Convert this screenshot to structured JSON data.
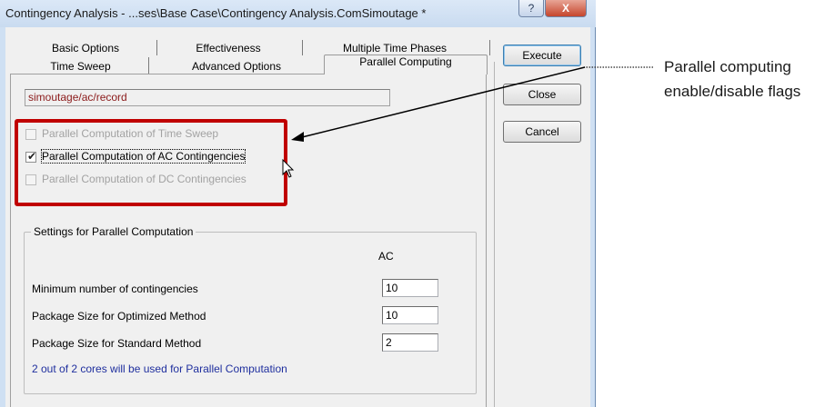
{
  "window": {
    "title": "Contingency Analysis - ...ses\\Base Case\\Contingency Analysis.ComSimoutage *",
    "help_glyph": "?",
    "close_glyph": "X"
  },
  "tabs": {
    "row_back": [
      "Basic Options",
      "Effectiveness",
      "Multiple Time Phases"
    ],
    "row_front": [
      "Time Sweep",
      "Advanced Options",
      "Parallel Computing"
    ],
    "active": "Parallel Computing"
  },
  "path_field": {
    "value": "simoutage/ac/record"
  },
  "checkboxes": [
    {
      "label": "Parallel Computation of Time Sweep",
      "checked": false,
      "enabled": false
    },
    {
      "label": "Parallel Computation of AC Contingencies",
      "checked": true,
      "enabled": true
    },
    {
      "label": "Parallel Computation of DC Contingencies",
      "checked": false,
      "enabled": false
    }
  ],
  "check_mark": "✔",
  "settings": {
    "group_title": "Settings for Parallel Computation",
    "column_header": "AC",
    "rows": [
      {
        "label": "Minimum number of contingencies",
        "value": "10"
      },
      {
        "label": "Package Size for Optimized Method",
        "value": "10"
      },
      {
        "label": "Package Size for Standard Method",
        "value": "2"
      }
    ],
    "cores_info": "2 out of 2 cores will be used for Parallel Computation"
  },
  "buttons": {
    "execute": "Execute",
    "close": "Close",
    "cancel": "Cancel"
  },
  "annotation": {
    "line1": "Parallel computing",
    "line2": "enable/disable flags"
  },
  "colors": {
    "highlight": "#c00000",
    "path_text": "#8b1a1a",
    "info_text": "#1f2f9e",
    "window_frame": "#cfe0f3",
    "close_button": "#c5452c"
  }
}
